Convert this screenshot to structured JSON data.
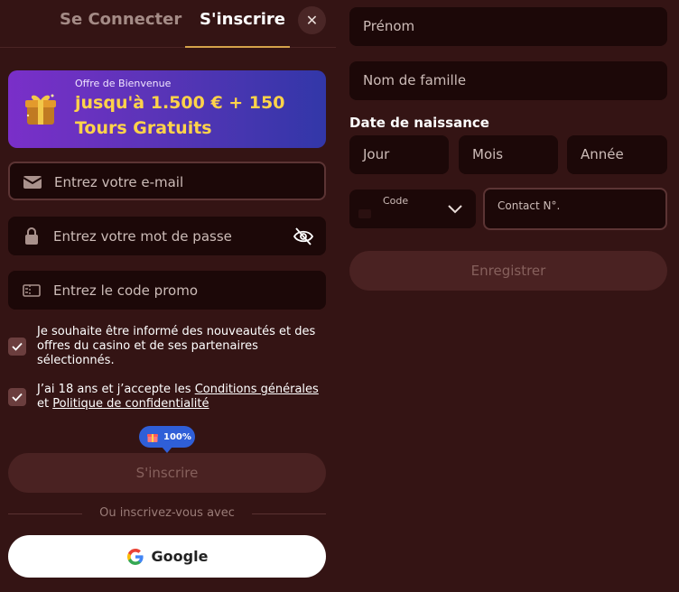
{
  "tabs": {
    "login": "Se Connecter",
    "register": "S'inscrire",
    "close": "✕"
  },
  "banner": {
    "kicker": "Offre de Bienvenue",
    "line1": "jusqu'à 1.500 € + 150",
    "line2": "Tours Gratuits"
  },
  "form": {
    "email_placeholder": "Entrez votre e-mail",
    "password_placeholder": "Entrez votre mot de passe",
    "promo_placeholder": "Entrez le code promo",
    "consent_news": "Je souhaite être informé des nouveautés et des offres du casino et de ses partenaires sélectionnés.",
    "consent_age_prefix": "J’ai 18 ans et j’accepte les ",
    "consent_terms_link": "Conditions générales",
    "consent_and": " et ",
    "consent_privacy_link": "Politique de confidentialité",
    "progress_badge": "100%",
    "submit_label": "S'inscrire",
    "divider_text": "Ou inscrivez-vous avec",
    "google_label": "Google"
  },
  "details": {
    "first_name_placeholder": "Prénom",
    "last_name_placeholder": "Nom de famille",
    "birthdate_label": "Date de naissance",
    "day_placeholder": "Jour",
    "month_placeholder": "Mois",
    "year_placeholder": "Année",
    "code_label": "Code",
    "contact_placeholder": "Contact N°.",
    "save_label": "Enregistrer"
  },
  "colors": {
    "background": "#341414",
    "field": "#1c0808",
    "accent_gold": "#d4a24a",
    "banner_text": "#ffd34a",
    "badge_blue": "#2f5fd8"
  },
  "icons": {
    "close": "close-icon",
    "gift": "gift-icon",
    "email": "mail-icon",
    "password": "lock-icon",
    "eye": "eye-off-icon",
    "promo": "ticket-icon",
    "check": "checkmark-icon",
    "google": "google-logo-icon",
    "chevron": "chevron-down-icon"
  }
}
